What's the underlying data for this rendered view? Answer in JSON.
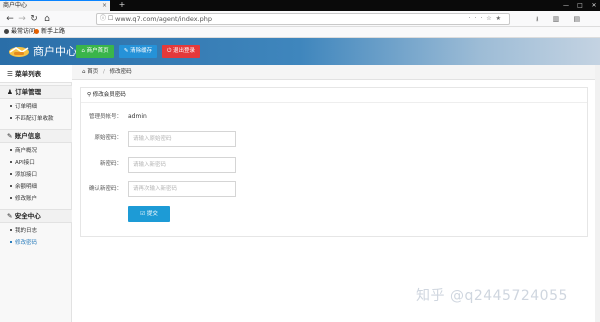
{
  "browser": {
    "tab_title": "商户中心",
    "tab_close": "×",
    "new_tab": "+",
    "url": "www.q7.com/agent/index.php",
    "bookmarks": [
      "最常访问",
      "新手上路"
    ]
  },
  "header": {
    "title": "商户中心",
    "buttons": [
      {
        "label": "商户首页",
        "color": "#3ab54a"
      },
      {
        "label": "清除缓存",
        "color": "#2592d8"
      },
      {
        "label": "退出登录",
        "color": "#e5393a"
      }
    ]
  },
  "sidebar": {
    "menu_title": "菜单列表",
    "sections": [
      {
        "title": "订单管理",
        "items": [
          "订单明细",
          "不匹配订单收款"
        ]
      },
      {
        "title": "账户信息",
        "items": [
          "商户概况",
          "API接口",
          "添加接口",
          "余额明细",
          "修改账户"
        ]
      },
      {
        "title": "安全中心",
        "items": [
          "我的日志",
          "修改密码"
        ]
      }
    ],
    "active_item": "修改密码"
  },
  "breadcrumb": {
    "home": "首页",
    "sep": "/",
    "current": "修改密码"
  },
  "form": {
    "heading": "修改会员密码",
    "account_label": "管理员帐号：",
    "account_value": "admin",
    "old_label": "原始密码：",
    "old_placeholder": "请输入原始密码",
    "new_label": "新密码：",
    "new_placeholder": "请输入新密码",
    "confirm_label": "确认新密码：",
    "confirm_placeholder": "请再次输入新密码",
    "submit_label": "提交"
  },
  "watermark": "知乎 @q2445724055"
}
